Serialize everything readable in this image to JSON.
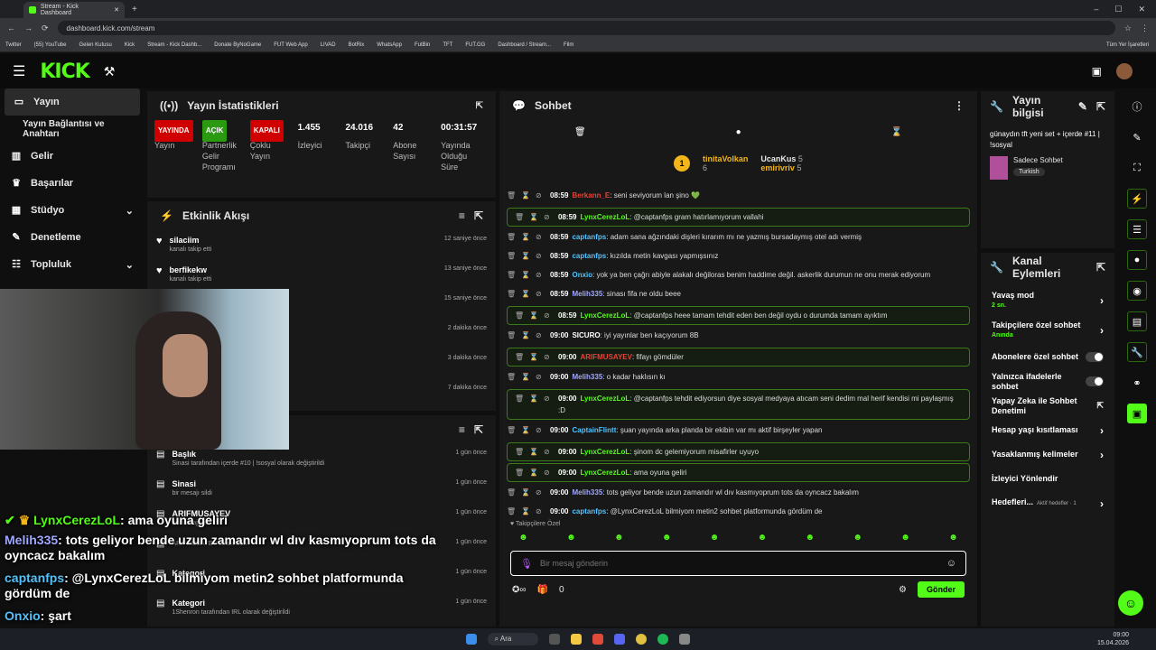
{
  "browser": {
    "tab_title": "Stream - Kick Dashboard",
    "url": "dashboard.kick.com/stream",
    "bookmarks": [
      "Twitter",
      "(55) YouTube",
      "Gelen Kutusu",
      "Kick",
      "Stream - Kick Dashb...",
      "Donate ByNoGame",
      "FUT Web App",
      "LIVAD",
      "BotRix",
      "WhatsApp",
      "FutBin",
      "TFT",
      "FUT.GG",
      "Dashboard / Stream...",
      "Film"
    ],
    "all_bookmarks": "Tüm Yer İşaretleri"
  },
  "kick": {
    "logo": "KICK",
    "beta": "BETA"
  },
  "sidebar": {
    "items": [
      {
        "label": "Yayın",
        "icon": "video-icon"
      },
      {
        "label": "Yayın Bağlantısı ve Anahtarı",
        "icon": ""
      },
      {
        "label": "Gelir",
        "icon": "chart-icon"
      },
      {
        "label": "Başarılar",
        "icon": "trophy-icon"
      },
      {
        "label": "Stüdyo",
        "icon": "studio-icon"
      },
      {
        "label": "Denetleme",
        "icon": "wrench-icon"
      },
      {
        "label": "Topluluk",
        "icon": "community-icon"
      }
    ]
  },
  "stats": {
    "title": "Yayın İstatistikleri",
    "items": [
      {
        "badge": "YAYINDA",
        "badge_color": "#d10000",
        "label": "Yayın"
      },
      {
        "badge": "AÇIK",
        "badge_color": "#2a9a10",
        "label": "Partnerlik Gelir Programı"
      },
      {
        "badge": "KAPALI",
        "badge_color": "#d10000",
        "label": "Çoklu Yayın"
      },
      {
        "value": "1.455",
        "label": "İzleyici"
      },
      {
        "value": "24.016",
        "label": "Takipçi"
      },
      {
        "value": "42",
        "label": "Abone Sayısı"
      },
      {
        "value": "00:31:57",
        "label": "Yayında Olduğu Süre"
      }
    ]
  },
  "activity": {
    "title": "Etkinlik Akışı",
    "events": [
      {
        "name": "silaciim",
        "sub": "kanalı takip etti",
        "time": "12 saniye önce"
      },
      {
        "name": "berfikekw",
        "sub": "kanalı takip etti",
        "time": "13 saniye önce"
      },
      {
        "name": "",
        "sub": "",
        "time": "15 saniye önce"
      },
      {
        "name": "",
        "sub": "",
        "time": "2 dakika önce"
      },
      {
        "name": "",
        "sub": "",
        "time": "3 dakika önce"
      },
      {
        "name": "",
        "sub": "",
        "time": "7 dakika önce"
      }
    ]
  },
  "modlog": {
    "events": [
      {
        "name": "Başlık",
        "sub": "Sinasi tarafından içerde #10 | !sosyal olarak değiştirildi",
        "time": "1 gün önce"
      },
      {
        "name": "Sinasi",
        "sub": "bir mesajı sildi",
        "time": "1 gün önce"
      },
      {
        "name": "ARIFMUSAYEV",
        "sub": "bir mesajı sildi",
        "time": "1 gün önce"
      },
      {
        "name": "",
        "sub": "ARIFMUSAYEV tarafından",
        "time": "1 gün önce"
      },
      {
        "name": "Kategori",
        "sub": "",
        "time": "1 gün önce"
      },
      {
        "name": "Kategori",
        "sub": "1Shenron tarafından IRL olarak değiştirildi",
        "time": "1 gün önce"
      }
    ]
  },
  "chat": {
    "title": "Sohbet",
    "leaderboard": [
      {
        "rank": "1",
        "name": "tinitaVolkan",
        "count": "6"
      },
      {
        "name": "UcanKus",
        "count": "5"
      },
      {
        "name": "emirivriv",
        "count": "5"
      }
    ],
    "messages": [
      {
        "time": "08:59",
        "user": "Berkann_E",
        "color": "#e0453a",
        "text": "seni seviyorum lan şino 💚",
        "hl": false
      },
      {
        "time": "08:59",
        "user": "LynxCerezLoL",
        "color": "#53fc18",
        "text": "@captanfps gram hatırlamıyorum vallahi",
        "hl": true
      },
      {
        "time": "08:59",
        "user": "captanfps",
        "color": "#53c2fc",
        "text": "adam sana ağzındaki dişleri kırarım mı ne yazmış bursadaymış otel adı vermiş",
        "hl": false
      },
      {
        "time": "08:59",
        "user": "captanfps",
        "color": "#53c2fc",
        "text": "kızılda metin kavgası yapmışsınız",
        "hl": false
      },
      {
        "time": "08:59",
        "user": "Onxio",
        "color": "#53c2fc",
        "text": "yok ya ben çağrı abiyle alakalı değiloras benim haddime değil. askerlik durumun ne onu merak ediyorum",
        "hl": false
      },
      {
        "time": "08:59",
        "user": "Melih335",
        "color": "#9fa8ff",
        "text": "sinası fifa ne oldu beee",
        "hl": false
      },
      {
        "time": "08:59",
        "user": "LynxCerezLoL",
        "color": "#53fc18",
        "text": "@captanfps heee tamam tehdit eden ben değil oydu o durumda tamam ayıktım",
        "hl": true
      },
      {
        "time": "09:00",
        "user": "SICURO",
        "color": "#ffffff",
        "text": "iyi yayınlar ben kaçıyorum 8B",
        "hl": false
      },
      {
        "time": "09:00",
        "user": "ARIFMUSAYEV",
        "color": "#e0453a",
        "text": "fifayı gömdüler",
        "hl": true
      },
      {
        "time": "09:00",
        "user": "Melih335",
        "color": "#9fa8ff",
        "text": "o kadar haklısın kı",
        "hl": false
      },
      {
        "time": "09:00",
        "user": "LynxCerezLoL",
        "color": "#53fc18",
        "text": "@captanfps tehdit ediyorsun diye sosyal medyaya atıcam seni dedim mal herif kendisi mi paylaşmış :D",
        "hl": true
      },
      {
        "time": "09:00",
        "user": "CaptainFlintt",
        "color": "#53c2fc",
        "text": "şuan yayında arka planda bir ekibin var mı aktif birşeyler yapan",
        "hl": false
      },
      {
        "time": "09:00",
        "user": "LynxCerezLoL",
        "color": "#53fc18",
        "text": "şinom dc gelemiyorum misafirler uyuyo",
        "hl": true
      },
      {
        "time": "09:00",
        "user": "LynxCerezLoL",
        "color": "#53fc18",
        "text": "ama oyuna geliri",
        "hl": true
      },
      {
        "time": "09:00",
        "user": "Melih335",
        "color": "#9fa8ff",
        "text": "tots geliyor bende uzun zamandır wl dıv kasmıyoprum tots da oyncacz bakalım",
        "hl": false
      },
      {
        "time": "09:00",
        "user": "captanfps",
        "color": "#53c2fc",
        "text": "@LynxCerezLoL bilmiyom metin2 sohbet platformunda gördüm de",
        "hl": false
      },
      {
        "time": "09:00",
        "user": "Onxio",
        "color": "#53c2fc",
        "text": "şart",
        "hl": false
      }
    ],
    "follower_only": "Takipçilere Özel",
    "placeholder": "Bir mesaj gönderin",
    "send": "Gönder",
    "count": "0"
  },
  "stream_info": {
    "title": "Yayın bilgisi",
    "stream_title": "günaydın tft yeni set + içerde #11 | !sosyal",
    "category": "Sadece Sohbet",
    "tag": "Turkish"
  },
  "channel_actions": {
    "title": "Kanal Eylemleri",
    "items": [
      {
        "label": "Yavaş mod",
        "sub": "2 sn.",
        "type": "arrow"
      },
      {
        "label": "Takipçilere özel sohbet",
        "sub": "Anında",
        "type": "arrow"
      },
      {
        "label": "Abonelere özel sohbet",
        "type": "toggle"
      },
      {
        "label": "Yalnızca ifadelerle sohbet",
        "type": "toggle"
      },
      {
        "label": "Yapay Zeka ile Sohbet Denetimi",
        "type": "ext"
      },
      {
        "label": "Hesap yaşı kısıtlaması",
        "type": "arrow"
      },
      {
        "label": "Yasaklanmış kelimeler",
        "type": "arrow"
      },
      {
        "label": "İzleyici Yönlendir",
        "type": "none"
      },
      {
        "label": "Hedefleri...",
        "sub_inline": "Aktif hedefler · 1",
        "type": "arrow"
      }
    ]
  },
  "overlay": [
    {
      "user": "LynxCerezLoL",
      "color": "#53fc18",
      "text": ": ama oyuna geliri"
    },
    {
      "user": "Melih335",
      "color": "#9fa8ff",
      "text": ": tots geliyor bende uzun zamandır wl dıv kasmıyoprum tots da oyncacz bakalım"
    },
    {
      "user": "captanfps",
      "color": "#53c2fc",
      "text": ": @LynxCerezLoL bilmiyom metin2 sohbet platformunda gördüm de"
    },
    {
      "user": "Onxio",
      "color": "#53c2fc",
      "text": ": şart"
    }
  ],
  "taskbar": {
    "search": "Ara",
    "time": "09:00",
    "date": "15.04.2026"
  }
}
